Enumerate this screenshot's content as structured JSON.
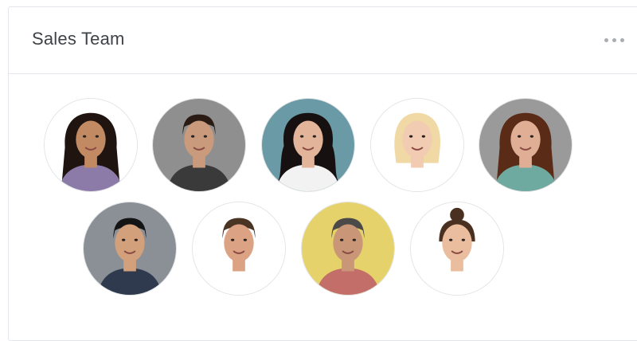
{
  "card": {
    "title": "Sales Team",
    "menu_icon": "more-horizontal-icon"
  },
  "team": {
    "member_count": 9,
    "members": [
      {
        "bg": "#ffffff",
        "skin": "#c28a62",
        "hair": "#1f1410",
        "shirt": "#8c7ba8",
        "hair_style": "long"
      },
      {
        "bg": "#8f8f8f",
        "skin": "#c99a7c",
        "hair": "#2a1c14",
        "shirt": "#3a3a3a",
        "hair_style": "short"
      },
      {
        "bg": "#6a9aa5",
        "skin": "#e2b49a",
        "hair": "#161010",
        "shirt": "#f2f2f2",
        "hair_style": "curly"
      },
      {
        "bg": "#ffffff",
        "skin": "#f1cbb2",
        "hair": "#f0d9a4",
        "shirt": "#ffffff",
        "hair_style": "bob"
      },
      {
        "bg": "#9a9a9a",
        "skin": "#e0ae94",
        "hair": "#5a2c18",
        "shirt": "#6faaa0",
        "hair_style": "long"
      },
      {
        "bg": "#8a9096",
        "skin": "#d3a07c",
        "hair": "#141414",
        "shirt": "#2f3a4e",
        "hair_style": "short"
      },
      {
        "bg": "#ffffff",
        "skin": "#dba384",
        "hair": "#4a3424",
        "shirt": "#ffffff",
        "hair_style": "short"
      },
      {
        "bg": "#e6d26a",
        "skin": "#c99778",
        "hair": "#4c4a48",
        "shirt": "#c46e6a",
        "hair_style": "short"
      },
      {
        "bg": "#ffffff",
        "skin": "#ebbd9f",
        "hair": "#4a3020",
        "shirt": "#ffffff",
        "hair_style": "bun"
      }
    ]
  }
}
